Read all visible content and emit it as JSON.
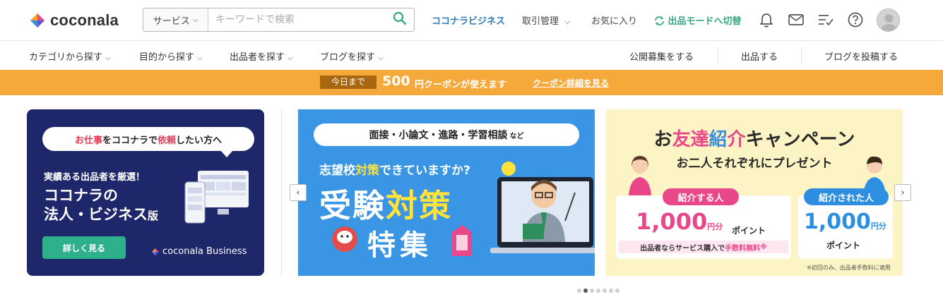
{
  "brand": {
    "name": "coconala"
  },
  "search": {
    "category_label": "サービス",
    "placeholder": "キーワードで検索"
  },
  "header_nav": {
    "business": "ココナラビジネス",
    "deal_manage": "取引管理",
    "favorites": "お気に入り",
    "switch_mode": "出品モードへ切替"
  },
  "subnav": {
    "category": "カテゴリから探す",
    "purpose": "目的から探す",
    "sellers": "出品者を探す",
    "blog": "ブログを探す",
    "public_request": "公開募集をする",
    "list_service": "出品する",
    "post_blog": "ブログを投稿する"
  },
  "coupon": {
    "tag": "今日まで",
    "amount": "500",
    "text": "円クーポンが使えます",
    "link": "クーポン詳細を見る"
  },
  "carousel": {
    "biz": {
      "bubble_a": "お",
      "bubble_b": "仕事",
      "bubble_c": "をココナラで",
      "bubble_d": "依頼",
      "bubble_e": "したい方へ",
      "line1": "実績ある出品者を厳選！",
      "line2": "ココナラの",
      "line3": "法人・ビジネス",
      "line3_small": "版",
      "button": "詳しく見る",
      "brand": "coconala Business"
    },
    "exam": {
      "pill": "面接・小論文・進路・学習相談",
      "pill_small": "など",
      "q_a": "志望校",
      "q_b": "対策",
      "q_c": "できていますか?",
      "big_a": "受験",
      "big_b": "対策",
      "big2": "特集"
    },
    "friend": {
      "title_a": "お",
      "title_b": "友達",
      "title_c": "紹",
      "title_d": "介",
      "title_e": "キャンペーン",
      "subtitle": "お二人それぞれにプレゼント",
      "tag1": "紹介する人",
      "tag2": "紹介された人",
      "amount1": "1,000",
      "amount1_unit": "円分",
      "point1": "ポイント",
      "note_a": "出品者ならサービス購入で",
      "note_b": "手数料無料",
      "note_c": "※",
      "amount2": "1,000",
      "amount2_unit": "円分",
      "point2": "ポイント",
      "footnote": "※初回のみ、出品者手数料に適用"
    },
    "prev_label": "‹",
    "next_label": "›",
    "dots": 7,
    "active_dot": 1
  },
  "colors": {
    "accent_blue": "#2a7bb8",
    "accent_green": "#3aa881",
    "coupon_bg": "#f6a93b"
  }
}
